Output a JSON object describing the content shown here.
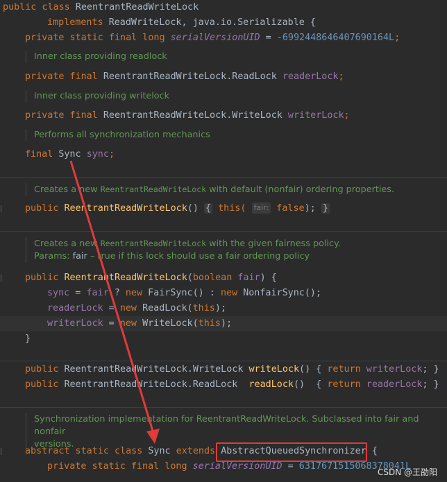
{
  "code": {
    "l1": {
      "kw": "public class ",
      "name": "ReentrantReadWriteLock"
    },
    "l2": {
      "kw": "implements ",
      "rest": "ReadWriteLock, java.io.Serializable {"
    },
    "l3": {
      "kw": "private static final long ",
      "field": "serialVersionUID",
      "eq": " = ",
      "num": "-6992448646407690164L",
      "semi": ";"
    },
    "doc1": "Inner class providing readlock",
    "l4": {
      "kw": "private final ",
      "type": "ReentrantReadWriteLock.ReadLock ",
      "field": "readerLock",
      "semi": ";"
    },
    "doc2": "Inner class providing writelock",
    "l5": {
      "kw": "private final ",
      "type": "ReentrantReadWriteLock.WriteLock ",
      "field": "writerLock",
      "semi": ";"
    },
    "doc3": "Performs all synchronization mechanics",
    "l6": {
      "kw": "final ",
      "type": "Sync ",
      "field": "sync",
      "semi": ";"
    },
    "doc4": {
      "a": "Creates a new ",
      "code": "ReentrantReadWriteLock",
      "b": " with default (nonfair) ordering properties."
    },
    "l7": {
      "kw": "public ",
      "fn": "ReentrantReadWriteLock",
      "paren": "() ",
      "open": "{",
      "this": " this(",
      "hint": "fair:",
      "false": " false",
      "close": ");",
      "end": "}"
    },
    "doc5": {
      "a": "Creates a new ",
      "code": "ReentrantReadWriteLock",
      "b": " with the given fairness policy."
    },
    "doc6": {
      "label": "Params: ",
      "param": "fair",
      "b": " – true if this lock should use a fair ordering policy"
    },
    "l8": {
      "kw": "public ",
      "fn": "ReentrantReadWriteLock",
      "open": "(",
      "kw2": "boolean ",
      "param": "fair",
      "end": ") {"
    },
    "l9": {
      "field": "sync",
      "eq": " = ",
      "param": "fair",
      "q": " ? ",
      "kw": "new ",
      "a": "FairSync() : ",
      "kw2": "new ",
      "b": "NonfairSync();"
    },
    "l10": {
      "field": "readerLock",
      "eq": " = ",
      "kw": "new ",
      "a": "ReadLock(",
      "kw2": "this",
      "b": ");"
    },
    "l11": {
      "field": "writerLock",
      "eq": " = ",
      "kw": "new ",
      "a": "WriteLock(",
      "kw2": "this",
      "b": ");"
    },
    "l12": "}",
    "l13": {
      "kw": "public ",
      "type": "ReentrantReadWriteLock.WriteLock ",
      "fn": "writeLock",
      "a": "() { ",
      "kw2": "return ",
      "field": "writerLock",
      "b": "; }"
    },
    "l14": {
      "kw": "public ",
      "type": "ReentrantReadWriteLock.ReadLock  ",
      "fn": "readLock",
      "a": "()  { ",
      "kw2": "return ",
      "field": "readerLock",
      "b": "; }"
    },
    "doc7a": "Synchronization implementation for ReentrantReadWriteLock. Subclassed into fair and nonfair",
    "doc7b": "versions.",
    "l15": {
      "kw": "abstract static class ",
      "type": "Sync ",
      "kw2": "extends ",
      "boxed": "AbstractQueuedSynchronizer",
      "end": " {"
    },
    "l16": {
      "kw": "private static final long ",
      "field": "serialVersionUID",
      "eq": " = ",
      "num": "6317671515068378041L"
    }
  },
  "watermark": "CSDN @王劭阳",
  "colors": {
    "keyword": "#cc7832",
    "method": "#ffc66d",
    "field": "#9876aa",
    "number": "#6897bb",
    "comment": "#629755",
    "annotation": "#e03b3b"
  }
}
